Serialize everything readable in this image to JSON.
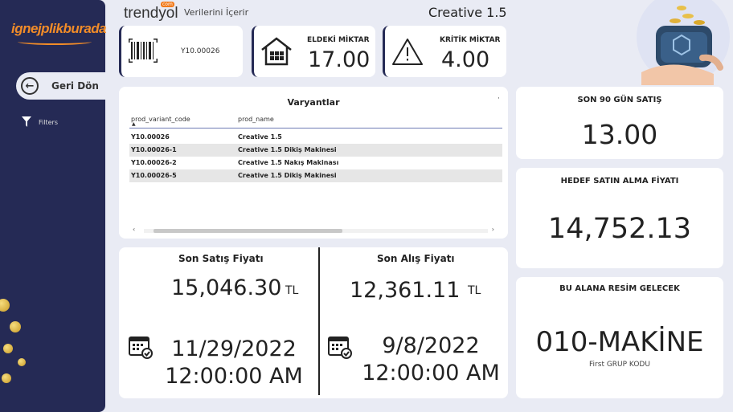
{
  "sidebar": {
    "logo_text": "ignejplikburada",
    "back_label": "Geri Dön",
    "filters_label": "Filters"
  },
  "header": {
    "brand": "trendyol",
    "brand_sup": "com",
    "description": "Verilerini İçerir",
    "title": "Creative 1.5"
  },
  "kpis": {
    "variant_code": "Y10.00026",
    "stock_label": "ELDEKİ MİKTAR",
    "stock_value": "17.00",
    "critical_label": "KRİTİK MİKTAR",
    "critical_value": "4.00"
  },
  "variants": {
    "title": "Varyantlar",
    "columns": [
      "prod_variant_code",
      "prod_name"
    ],
    "rows": [
      [
        "Y10.00026",
        "Creative 1.5"
      ],
      [
        "Y10.00026-1",
        "Creative 1.5 Dikiş Makinesi"
      ],
      [
        "Y10.00026-2",
        "Creative 1.5 Nakış Makinası"
      ],
      [
        "Y10.00026-5",
        "Creative 1.5 Dikiş Makinesi"
      ]
    ]
  },
  "sale": {
    "label": "Son Satış Fiyatı",
    "value": "15,046.30",
    "currency": "TL",
    "date": "11/29/2022",
    "time": "12:00:00 AM"
  },
  "purchase": {
    "label": "Son Alış Fiyatı",
    "value": "12,361.11",
    "currency": "TL",
    "date": "9/8/2022",
    "time": "12:00:00 AM"
  },
  "right": {
    "sales90_label": "SON 90 GÜN SATIŞ",
    "sales90_value": "13.00",
    "target_label": "HEDEF SATIN ALMA FİYATI",
    "target_value": "14,752.13",
    "image_label": "BU ALANA RESİM GELECEK",
    "group_value": "010-MAKİNE",
    "group_sub": "First GRUP KODU"
  },
  "colors": {
    "sidebar": "#252a55",
    "background": "#e9ebf4",
    "logo": "#f28c28",
    "brand_badge": "#f27a1a"
  }
}
